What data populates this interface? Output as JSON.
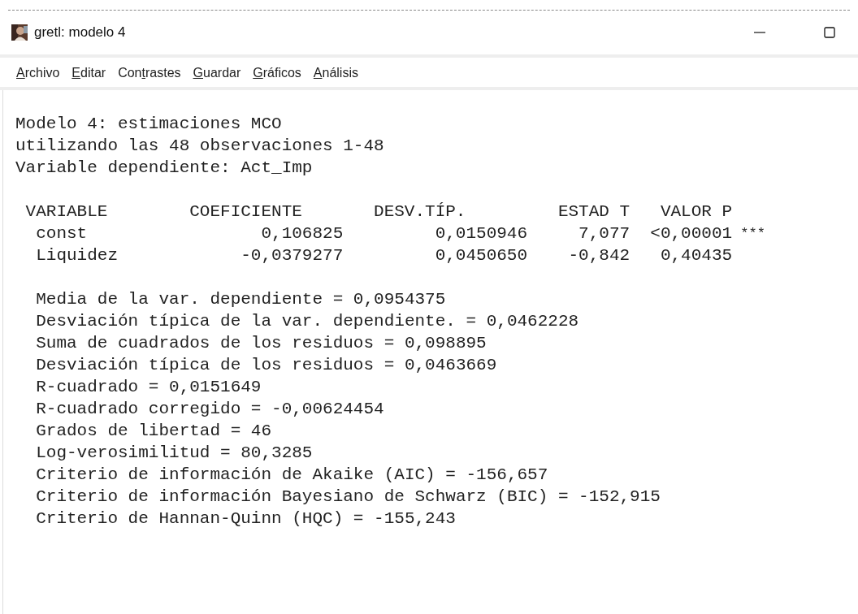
{
  "window": {
    "title": "gretl: modelo 4"
  },
  "menu": [
    {
      "key": "A",
      "after": "rchivo"
    },
    {
      "key": "E",
      "after": "ditar"
    },
    {
      "before": "Con",
      "key": "t",
      "after": "rastes"
    },
    {
      "key": "G",
      "after": "uardar"
    },
    {
      "key": "G",
      "after": "ráficos"
    },
    {
      "key": "A",
      "after": "nálisis"
    }
  ],
  "output": {
    "heading": [
      "Modelo 4: estimaciones MCO",
      "utilizando las 48 observaciones 1-48",
      "Variable dependiente: Act_Imp"
    ],
    "table": {
      "columns": [
        "VARIABLE",
        "COEFICIENTE",
        "DESV.TÍP.",
        "ESTAD T",
        "VALOR P"
      ],
      "rows": [
        {
          "variable": "const",
          "coefficient": "0,106825",
          "std_error": "0,0150946",
          "t_stat": "7,077",
          "p_value": "<0,00001",
          "significance": "***"
        },
        {
          "variable": "Liquidez",
          "coefficient": "-0,0379277",
          "std_error": "0,0450650",
          "t_stat": "-0,842",
          "p_value": "0,40435"
        }
      ]
    },
    "statistics": [
      "Media de la var. dependiente = 0,0954375",
      "Desviación típica de la var. dependiente. = 0,0462228",
      "Suma de cuadrados de los residuos = 0,098895",
      "Desviación típica de los residuos = 0,0463669",
      "R-cuadrado = 0,0151649",
      "R-cuadrado corregido = -0,00624454",
      "Grados de libertad = 46",
      "Log-verosimilitud = 80,3285",
      "Criterio de información de Akaike (AIC) = -156,657",
      "Criterio de información Bayesiano de Schwarz (BIC) = -152,915",
      "Criterio de Hannan-Quinn (HQC) = -155,243"
    ]
  }
}
